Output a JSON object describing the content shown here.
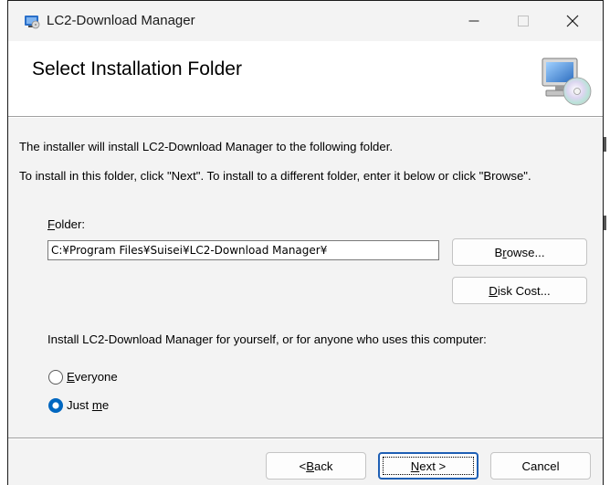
{
  "window": {
    "title": "LC2-Download Manager",
    "controls": {
      "minimize": "minimize",
      "maximize": "maximize",
      "close": "close"
    }
  },
  "banner": {
    "title": "Select Installation Folder",
    "art_icon": "computer-disc-icon"
  },
  "body": {
    "intro_line1": "The installer will install LC2-Download Manager to the following folder.",
    "intro_line2": "To install in this folder, click \"Next\". To install to a different folder, enter it below or click \"Browse\".",
    "folder_label_accel": "F",
    "folder_label_rest": "older:",
    "folder_value": "C:¥Program Files¥Suisei¥LC2-Download Manager¥",
    "browse_accel": "r",
    "browse_pre": "B",
    "browse_post": "owse...",
    "disk_accel": "D",
    "disk_rest": "isk Cost...",
    "install_for": "Install LC2-Download Manager for yourself, or for anyone who uses this computer:",
    "everyone_accel": "E",
    "everyone_rest": "veryone",
    "justme_pre": "Just ",
    "justme_accel": "m",
    "justme_post": "e",
    "selected_option": "Just me"
  },
  "footer": {
    "back_pre": "< ",
    "back_accel": "B",
    "back_post": "ack",
    "next_accel": "N",
    "next_post": "ext >",
    "cancel": "Cancel"
  },
  "colors": {
    "accent": "#0067c0",
    "window_bg": "#f3f3f3",
    "banner_bg": "#ffffff"
  }
}
